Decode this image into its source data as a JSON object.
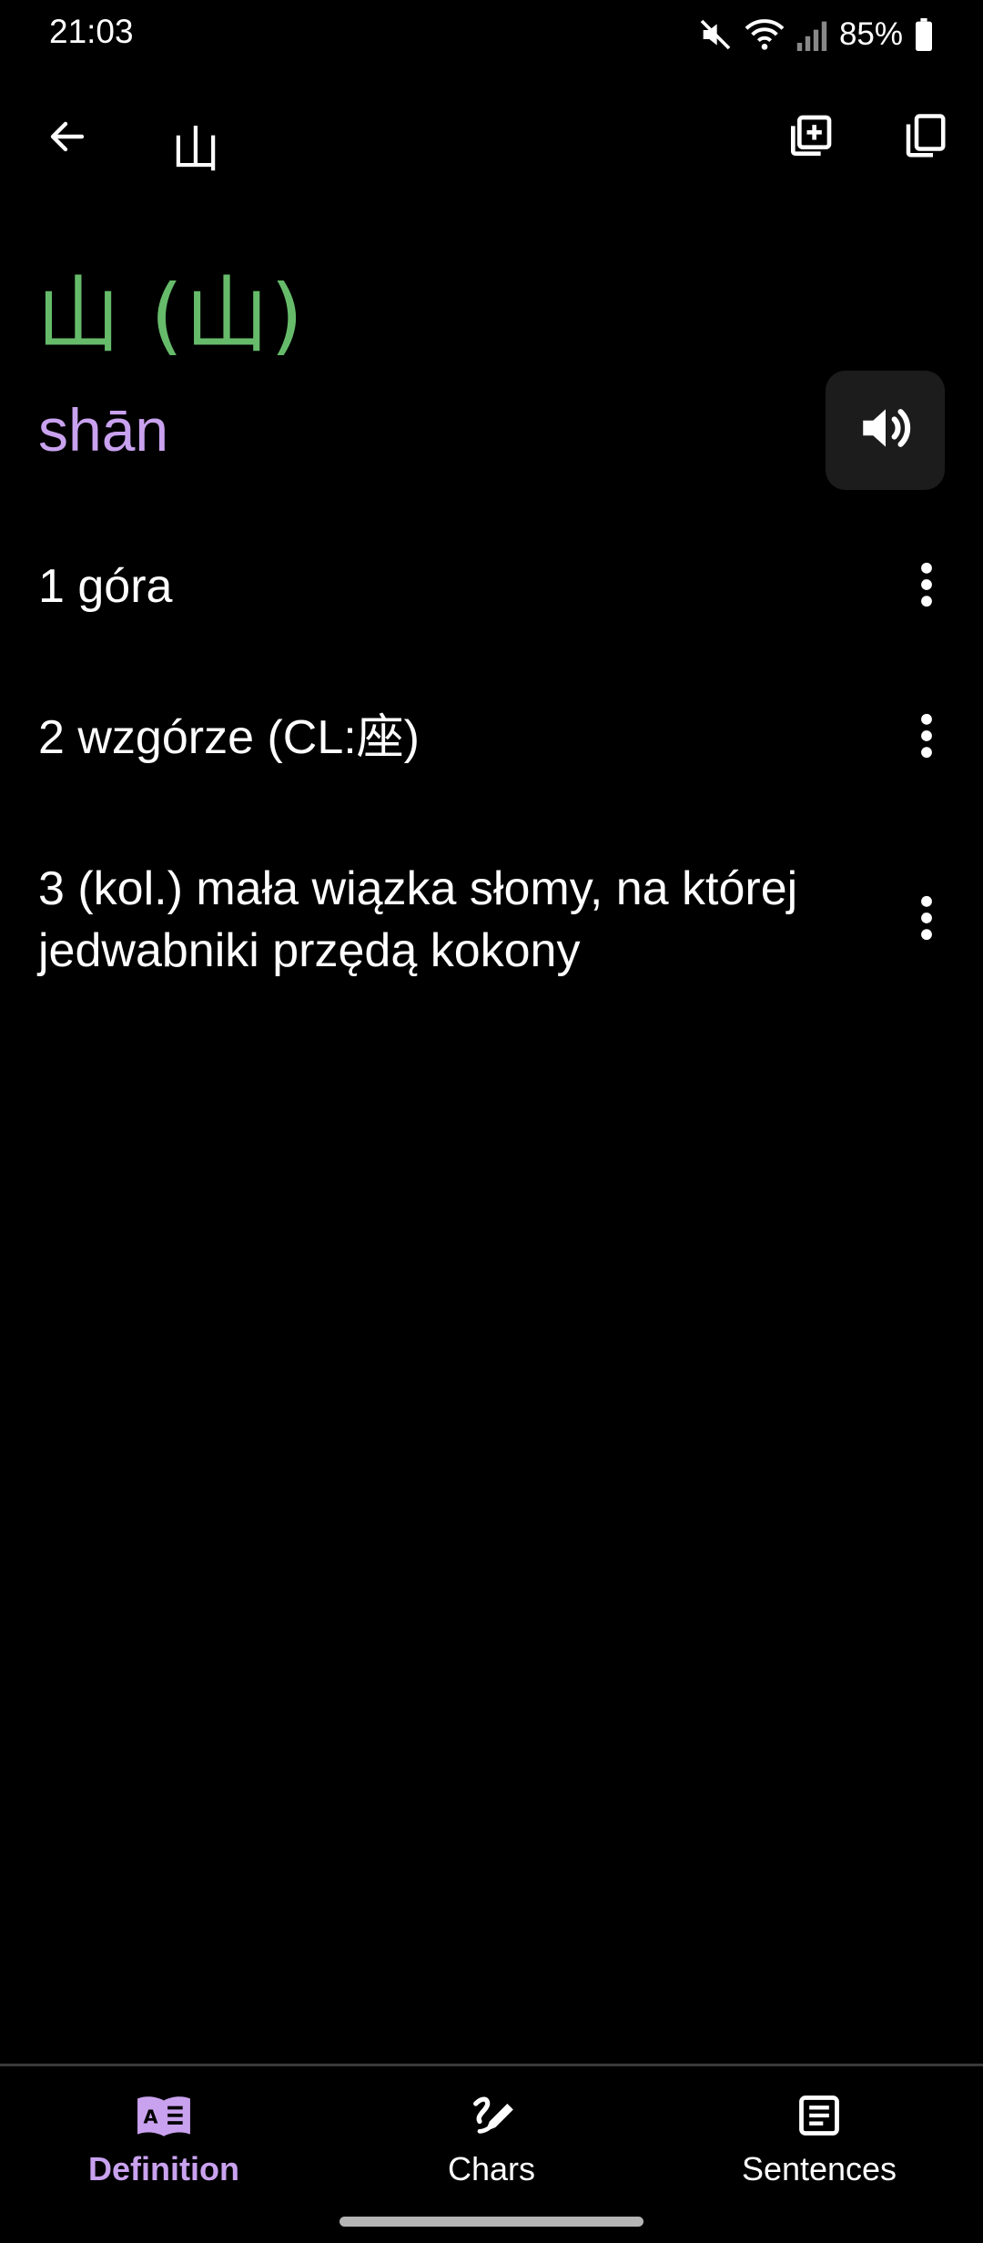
{
  "status_bar": {
    "time": "21:03",
    "battery": "85%",
    "icons": [
      "mute-icon",
      "wifi-icon",
      "signal-icon",
      "battery-icon"
    ]
  },
  "top_bar": {
    "title": "山",
    "icons": [
      "back-arrow-icon",
      "add-to-deck-icon",
      "copy-icon"
    ]
  },
  "word": {
    "headline": "山 (山)",
    "pinyin": "shān",
    "audio_icon": "speaker-icon"
  },
  "definitions": [
    {
      "text": "1 góra"
    },
    {
      "text": "2 wzgórze (CL:座)"
    },
    {
      "text": "3 (kol.) mała wiązka słomy, na której jedwabniki przędą kokony"
    }
  ],
  "bottom_nav": {
    "items": [
      {
        "label": "Definition",
        "icon": "dictionary-book-icon",
        "active": true
      },
      {
        "label": "Chars",
        "icon": "brush-stroke-icon",
        "active": false
      },
      {
        "label": "Sentences",
        "icon": "sentences-list-icon",
        "active": false
      }
    ]
  },
  "colors": {
    "background": "#000000",
    "headline": "#66bb6a",
    "pinyin_accent": "#c9a2ef",
    "text": "#ffffff",
    "audio_button_bg": "#1c1c1c"
  }
}
